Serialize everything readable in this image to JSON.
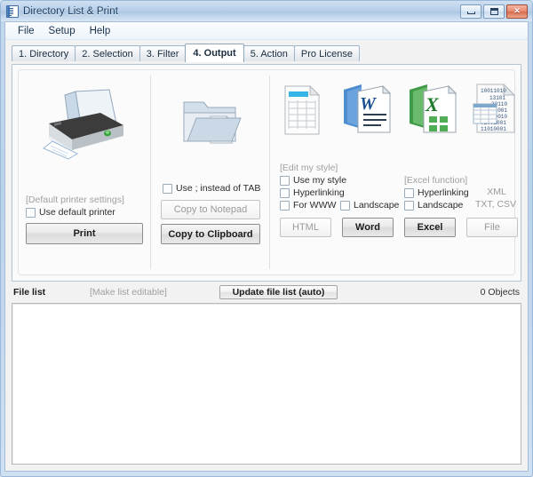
{
  "window": {
    "title": "Directory List & Print",
    "icon": "list-document-icon",
    "controls": {
      "minimize": "minimize-button",
      "maximize": "maximize-button",
      "close_glyph": "✕"
    }
  },
  "menu": {
    "items": [
      "File",
      "Setup",
      "Help"
    ]
  },
  "tabs": [
    {
      "label": "1. Directory",
      "active": false
    },
    {
      "label": "2. Selection",
      "active": false
    },
    {
      "label": "3. Filter",
      "active": false
    },
    {
      "label": "4. Output",
      "active": true
    },
    {
      "label": "5. Action",
      "active": false
    },
    {
      "label": "Pro License",
      "active": false
    }
  ],
  "output": {
    "print_panel": {
      "icon": "printer-icon",
      "settings_label": "[Default printer settings]",
      "use_default_printer": {
        "label": "Use default printer",
        "checked": false
      },
      "print_button": "Print"
    },
    "notepad_panel": {
      "icon": "folder-document-icon",
      "semicolon_option": {
        "label": "Use  ;  instead of TAB",
        "checked": false
      },
      "copy_to_notepad_button": "Copy to Notepad",
      "copy_to_clipboard_button": "Copy to Clipboard"
    },
    "apps_panel": {
      "icons": [
        "html-table-document-icon",
        "word-document-icon",
        "excel-spreadsheet-icon",
        "binary-file-document-icon"
      ],
      "edit_style_label": "[Edit my style]",
      "excel_function_label": "[Excel function]",
      "html_options": [
        {
          "label": "Use my style",
          "checked": false
        },
        {
          "label": "Hyperlinking",
          "checked": false
        },
        {
          "label": "For WWW",
          "checked": false
        }
      ],
      "word_options": [
        {
          "label": "Landscape",
          "checked": false
        }
      ],
      "excel_options": [
        {
          "label": "Hyperlinking",
          "checked": false
        },
        {
          "label": "Landscape",
          "checked": false
        }
      ],
      "file_formats": [
        "XML",
        "TXT, CSV"
      ],
      "buttons": [
        {
          "label": "HTML",
          "enabled": false
        },
        {
          "label": "Word",
          "enabled": true
        },
        {
          "label": "Excel",
          "enabled": true
        },
        {
          "label": "File",
          "enabled": false
        }
      ]
    }
  },
  "file_list": {
    "label": "File list",
    "make_editable": "[Make list editable]",
    "update_button": "Update file list (auto)",
    "object_count": "0 Objects",
    "rows": []
  },
  "colors": {
    "titlebar_text": "#1a3c5e",
    "close_button": "#d66a4e",
    "accent_blue": "#4f86c6",
    "disabled_text": "#9a9a9a",
    "list_background": "#ffffff"
  }
}
